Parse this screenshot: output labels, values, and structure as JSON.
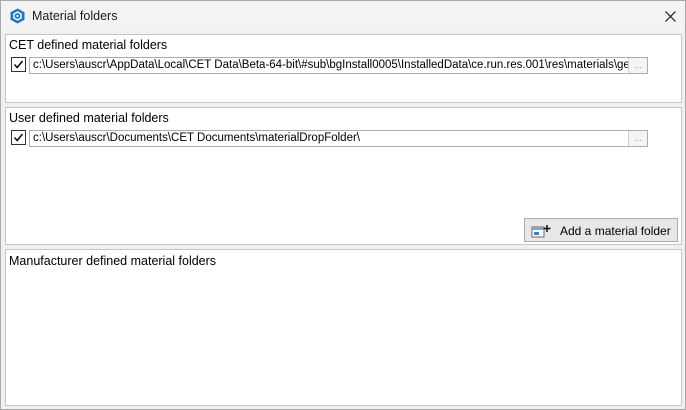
{
  "window": {
    "title": "Material folders",
    "app_icon": "cet-hexagon-icon",
    "close_icon": "close-icon"
  },
  "cet_panel": {
    "title": "CET defined material folders",
    "rows": [
      {
        "checked": true,
        "path": "c:\\Users\\auscr\\AppData\\Local\\CET Data\\Beta-64-bit\\#sub\\bgInstall0005\\InstalledData\\ce.run.res.001\\res\\materials\\ge",
        "browse_label": "..."
      }
    ]
  },
  "user_panel": {
    "title": "User defined material folders",
    "rows": [
      {
        "checked": true,
        "path": "c:\\Users\\auscr\\Documents\\CET Documents\\materialDropFolder\\",
        "browse_label": "..."
      }
    ],
    "add_button": {
      "label": "Add a material folder",
      "icon": "add-folder-icon"
    }
  },
  "manufacturer_panel": {
    "title": "Manufacturer defined material folders"
  }
}
